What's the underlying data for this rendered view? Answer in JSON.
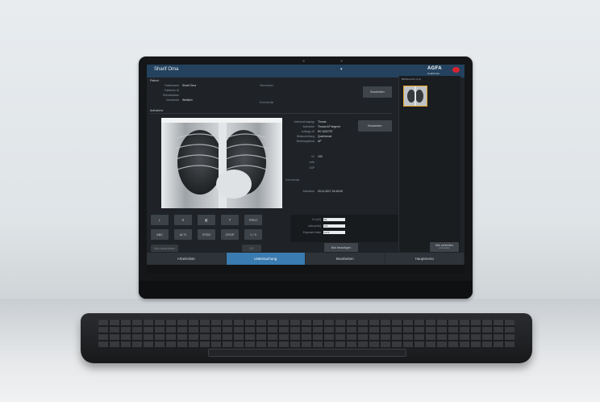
{
  "app": {
    "patient_name": "Sharif Oma",
    "brand": "AGFA",
    "brand_sub": "HealthCare"
  },
  "patient": {
    "section": "Patient",
    "fields": [
      {
        "label": "Patientname",
        "value": "Sharif Oma"
      },
      {
        "label": "Patienten-ID",
        "value": ""
      },
      {
        "label": "Geburtsdatum",
        "value": ""
      },
      {
        "label": "Geschlecht",
        "value": "Weiblich"
      }
    ],
    "side_label": "Überweiser",
    "side_label2": "Kommentar",
    "edit_label": "Bearbeiten"
  },
  "exam": {
    "section": "Aufnahme",
    "fields": [
      {
        "label": "Untersuchungstyp",
        "value": "Thorax"
      },
      {
        "label": "Aufnahme",
        "value": "Thorax AP liegend"
      },
      {
        "label": "Auftrags-ID",
        "value": "R0 1002797"
      },
      {
        "label": "Bildausrichtung",
        "value": "Querformat"
      },
      {
        "label": "Strahlungsdosis",
        "value": "AP"
      }
    ],
    "dose_fields": [
      {
        "label": "kV",
        "value": "100"
      },
      {
        "label": "mAs",
        "value": ""
      },
      {
        "label": "DAP",
        "value": ""
      }
    ],
    "comment_label": "Kommentar",
    "date_label": "Aufnahme",
    "date_value": "03.11.2017 16:16:00",
    "edit_label": "Bearbeiten"
  },
  "tools": {
    "row1": [
      "L",
      "R",
      "",
      "",
      "PROJ"
    ],
    "row2": [
      "ABC",
      "ALT1",
      "STDD",
      "CROP",
      "1 / 9"
    ]
  },
  "params": [
    {
      "label": "kV (kV)",
      "value": "81"
    },
    {
      "label": "mAs (mAs)",
      "value": "3.5"
    },
    {
      "label": "Exposure Index",
      "value": "1174"
    }
  ],
  "actions": {
    "disabled1": "Neu aufnehmen",
    "disabled2": "OK",
    "add_image": "Bild hinzufügen",
    "close_study": "Alle schließen",
    "close_study_sub": "und senden"
  },
  "thumbs": {
    "header": "Bildübersicht (1/1)"
  },
  "tabs": [
    {
      "label": "Arbeitsliste",
      "active": false
    },
    {
      "label": "Untersuchung",
      "active": true
    },
    {
      "label": "Bearbeiten",
      "active": false
    },
    {
      "label": "Hauptmenü",
      "active": false
    }
  ],
  "colors": {
    "accent": "#3a7bb0",
    "titlebar": "#24425e",
    "brand_red": "#d9232e",
    "thumb_highlight": "#e2a526"
  }
}
